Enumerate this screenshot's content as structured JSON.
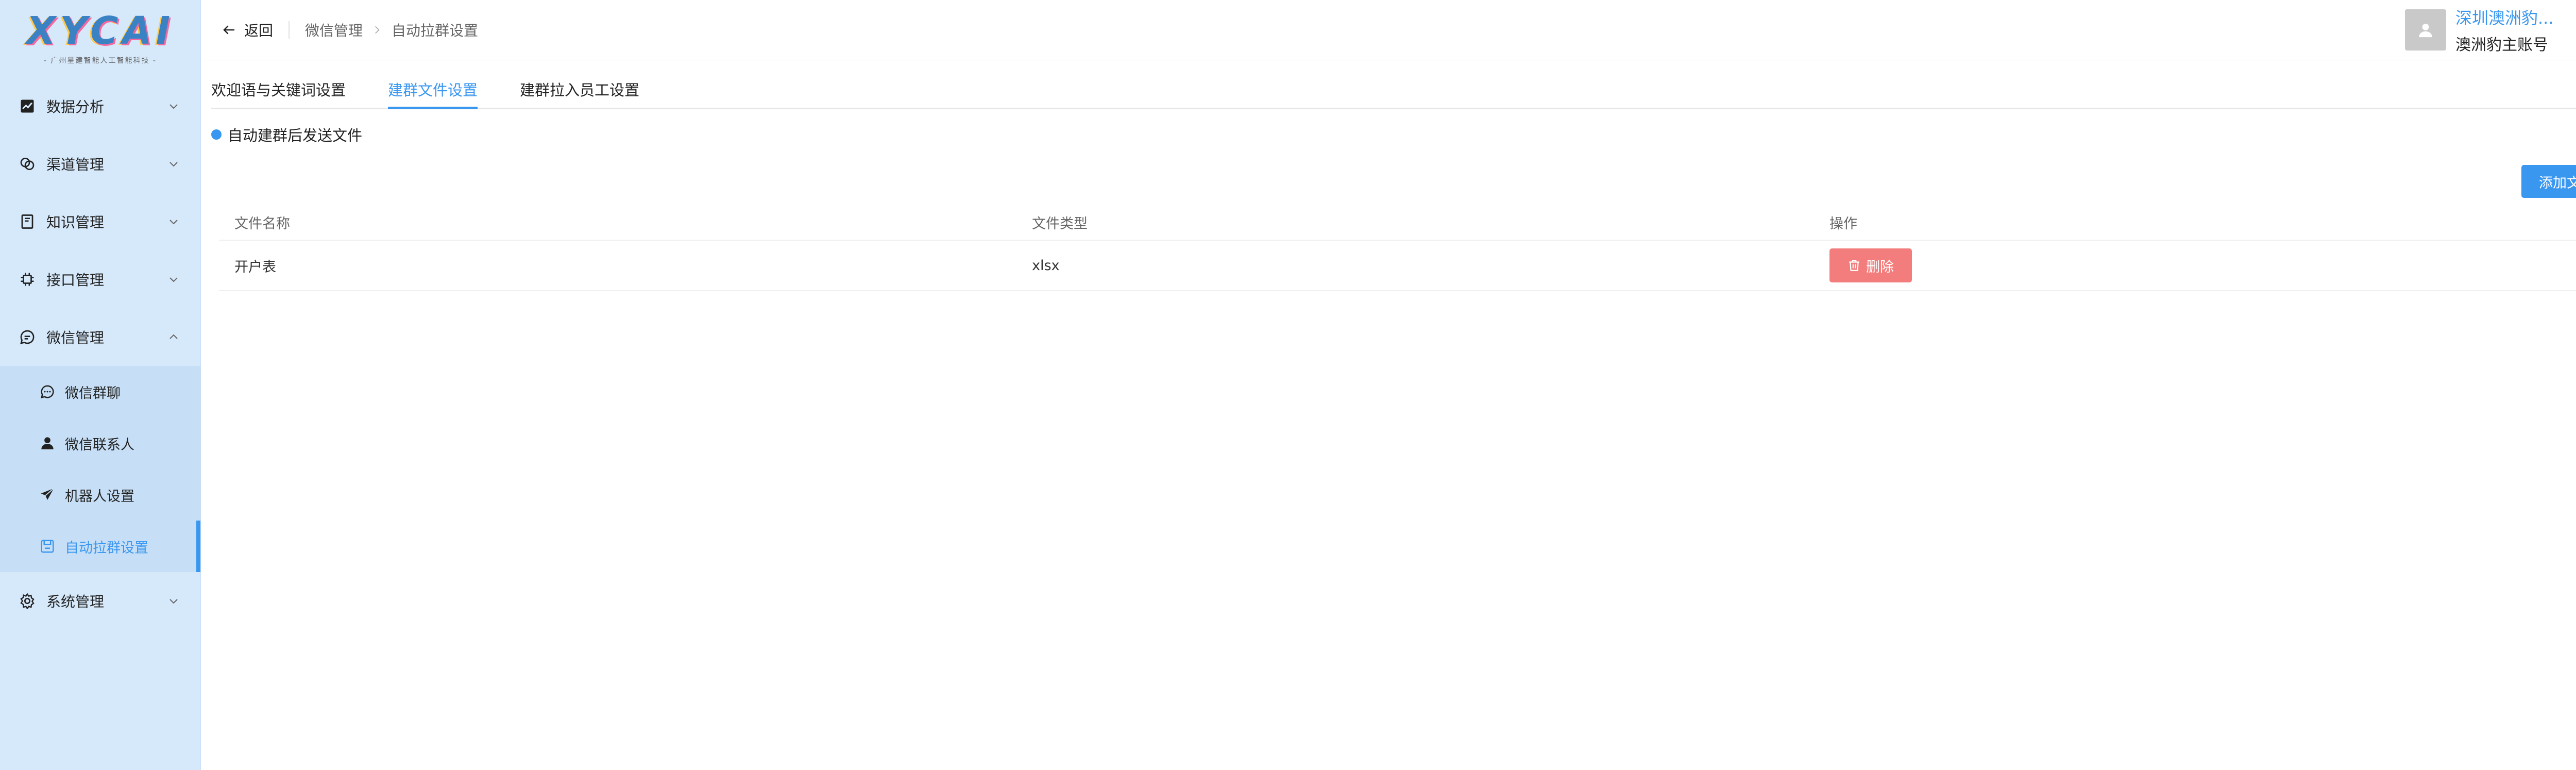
{
  "brand": {
    "logo_text": "XYCAI",
    "tagline": "- 广州星建智能人工智能科技 -"
  },
  "sidebar": {
    "items": [
      {
        "label": "数据分析",
        "icon": "chart-line-icon"
      },
      {
        "label": "渠道管理",
        "icon": "channels-icon"
      },
      {
        "label": "知识管理",
        "icon": "book-icon"
      },
      {
        "label": "接口管理",
        "icon": "chip-icon"
      },
      {
        "label": "微信管理",
        "icon": "chat-bubble-icon"
      }
    ],
    "wechat_sub": [
      {
        "label": "微信群聊",
        "icon": "chat-icon"
      },
      {
        "label": "微信联系人",
        "icon": "user-icon"
      },
      {
        "label": "机器人设置",
        "icon": "paper-plane-icon"
      },
      {
        "label": "自动拉群设置",
        "icon": "save-icon"
      }
    ],
    "system": {
      "label": "系统管理",
      "icon": "gear-icon"
    }
  },
  "header": {
    "back_label": "返回",
    "breadcrumb": [
      "微信管理",
      "自动拉群设置"
    ],
    "org_name": "深圳澳洲豹...",
    "account_name": "澳洲豹主账号"
  },
  "tabs": [
    {
      "label": "欢迎语与关键词设置"
    },
    {
      "label": "建群文件设置"
    },
    {
      "label": "建群拉入员工设置"
    }
  ],
  "section": {
    "title": "自动建群后发送文件"
  },
  "add_button": "添加文件",
  "table": {
    "headers": [
      "文件名称",
      "文件类型",
      "操作"
    ],
    "rows": [
      {
        "name": "开户表",
        "type": "xlsx",
        "action": "删除"
      }
    ]
  },
  "colors": {
    "accent": "#3a97f0",
    "sidebar_bg": "#d6e9fb",
    "danger": "#f37d7d"
  }
}
